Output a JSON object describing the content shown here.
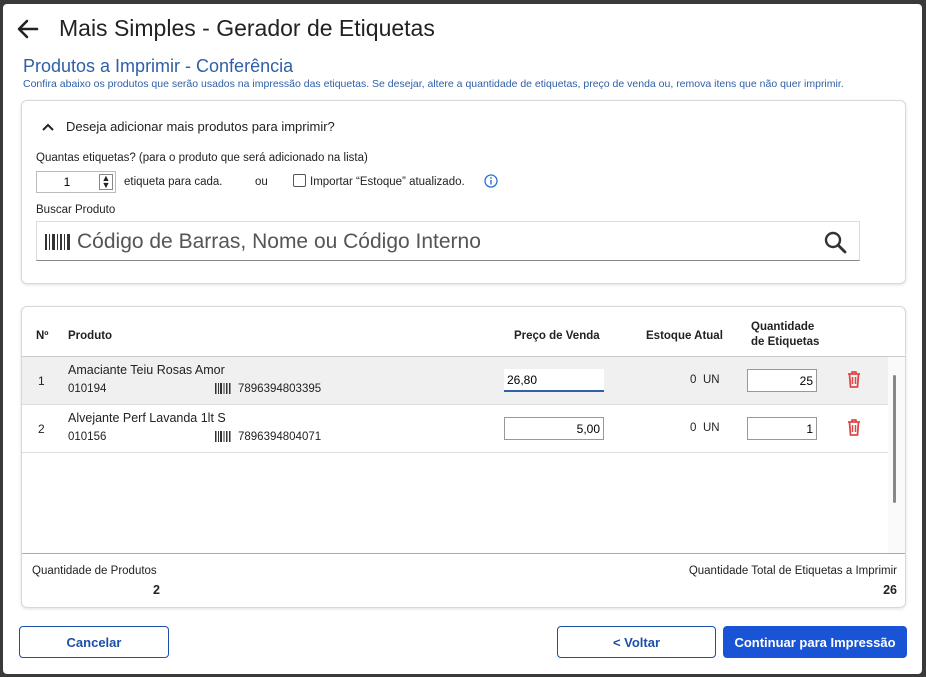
{
  "window": {
    "title": "Mais Simples - Gerador de Etiquetas"
  },
  "section": {
    "title": "Produtos a Imprimir - Conferência",
    "subtitle": "Confira abaixo os produtos que serão usados na impressão das etiquetas. Se desejar, altere a quantidade de etiquetas, preço de venda ou, remova itens que não quer imprimir."
  },
  "add_panel": {
    "toggle_label": "Deseja adicionar mais produtos para imprimir?",
    "qty_label": "Quantas etiquetas? (para o produto que será adicionado na lista)",
    "qty_value": "1",
    "per_each": "etiqueta para cada.",
    "ou": "ou",
    "import_label": "Importar “Estoque” atualizado.",
    "import_checked": false,
    "search_label": "Buscar Produto",
    "search_placeholder": "Código de Barras, Nome ou Código Interno"
  },
  "table": {
    "headers": {
      "num": "Nº",
      "product": "Produto",
      "price": "Preço de Venda",
      "stock": "Estoque Atual",
      "qty_line1": "Quantidade",
      "qty_line2": "de Etiquetas"
    },
    "rows": [
      {
        "num": "1",
        "name": "Amaciante Teiu Rosas Amor",
        "code": "010194",
        "barcode": "7896394803395",
        "price": "26,80",
        "stock": "0",
        "unit": "UN",
        "qty": "25"
      },
      {
        "num": "2",
        "name": "Alvejante Perf Lavanda 1lt S",
        "code": "010156",
        "barcode": "7896394804071",
        "price": "5,00",
        "stock": "0",
        "unit": "UN",
        "qty": "1"
      }
    ],
    "footer": {
      "products_label": "Quantidade de Produtos",
      "products_value": "2",
      "total_label": "Quantidade Total de Etiquetas a Imprimir",
      "total_value": "26"
    }
  },
  "buttons": {
    "cancel": "Cancelar",
    "back": "< Voltar",
    "continue": "Continuar para Impressão"
  },
  "colors": {
    "accent": "#2e5fa8",
    "primary_button": "#1a54d6",
    "delete": "#e04848"
  }
}
